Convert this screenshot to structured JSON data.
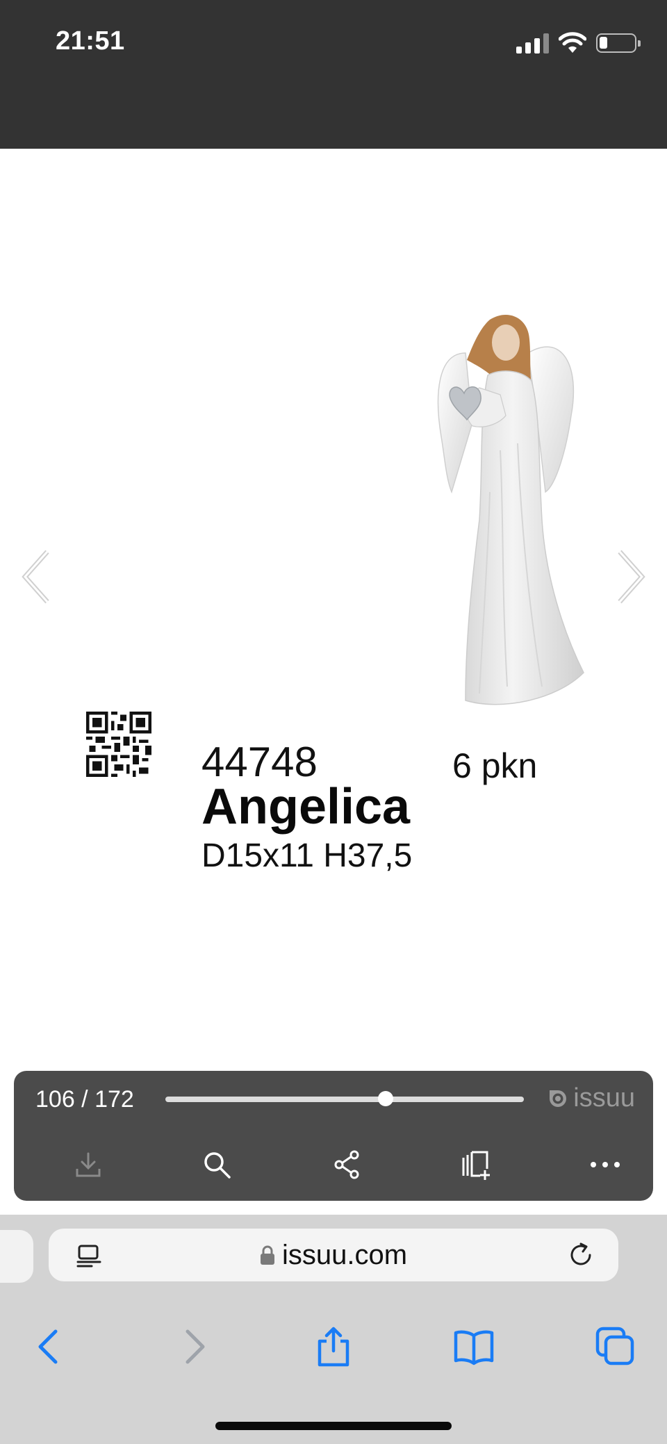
{
  "status_bar": {
    "time": "21:51",
    "icons": [
      "cellular-signal-icon",
      "wifi-icon",
      "battery-icon"
    ],
    "battery_level": 0.2
  },
  "viewer": {
    "prev_icon": "chevron-left-icon",
    "next_icon": "chevron-right-icon"
  },
  "product": {
    "code": "44748",
    "pack": "6 pkn",
    "name": "Angelica",
    "dimensions": "D15x11 H37,5",
    "image": "angel-figurine"
  },
  "reader_toolbar": {
    "page_counter": "106 / 172",
    "current_page": 106,
    "total_pages": 172,
    "brand": "issuu",
    "tools": [
      "download-icon",
      "search-icon",
      "share-icon",
      "add-to-stack-icon",
      "more-icon"
    ],
    "colors": {
      "bar": "#4b4b4b",
      "track": "#dddddd",
      "brand": "#9a9a9a"
    }
  },
  "browser": {
    "url": "issuu.com",
    "icons": [
      "reader-mode-icon",
      "lock-icon",
      "reload-icon"
    ],
    "nav": [
      "back-icon",
      "forward-icon",
      "share-sheet-icon",
      "bookmarks-icon",
      "tabs-icon"
    ],
    "accent": "#1a7cf5"
  }
}
